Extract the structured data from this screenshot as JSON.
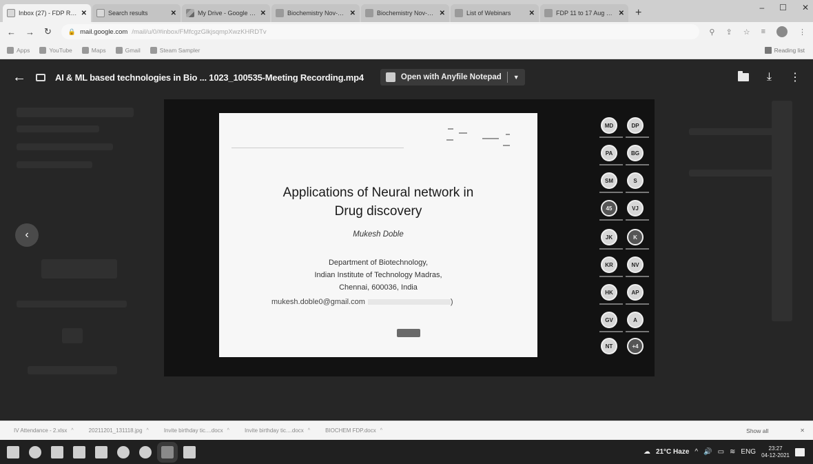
{
  "browser": {
    "tabs": [
      {
        "title": "Inbox (27) - FDP Recording",
        "favicon": "gmail"
      },
      {
        "title": "Search results",
        "favicon": "gmail"
      },
      {
        "title": "My Drive - Google Drive",
        "favicon": "drive"
      },
      {
        "title": "Biochemistry Nov-Dec",
        "favicon": "doc"
      },
      {
        "title": "Biochemistry Nov-Dec",
        "favicon": "doc"
      },
      {
        "title": "List of Webinars",
        "favicon": "doc"
      },
      {
        "title": "FDP 11 to 17 Aug 2021",
        "favicon": "doc"
      }
    ],
    "new_tab_label": "+",
    "window_controls": {
      "minimize": "–",
      "maximize": "☐",
      "close": "✕"
    },
    "url_host": "mail.google.com",
    "url_path": "/mail/u/0/#inbox/FMfcgzGlkjsqmpXwzKHRDTv",
    "bookmarks": [
      {
        "label": "Apps",
        "icon": "apps-grid-icon"
      },
      {
        "label": "YouTube",
        "icon": "youtube-icon"
      },
      {
        "label": "Maps",
        "icon": "maps-icon"
      },
      {
        "label": "Gmail",
        "icon": "gmail-icon"
      },
      {
        "label": "Steam Sampler",
        "icon": "steam-icon"
      }
    ],
    "reading_list_label": "Reading list"
  },
  "viewer": {
    "file_name": "AI & ML based technologies in Bio ... 1023_100535-Meeting Recording.mp4",
    "open_with_label": "Open with Anyfile Notepad"
  },
  "slide": {
    "title_line1": "Applications of Neural network in",
    "title_line2": "Drug discovery",
    "author": "Mukesh Doble",
    "aff_line1": "Department of Biotechnology,",
    "aff_line2": "Indian Institute of Technology Madras,",
    "aff_line3": "Chennai, 600036, India",
    "email": "mukesh.doble0@gmail.com",
    "email_tail": ")"
  },
  "participants": [
    {
      "initials": "MD",
      "dark": false
    },
    {
      "initials": "DP",
      "dark": false
    },
    {
      "initials": "PA",
      "dark": false
    },
    {
      "initials": "BG",
      "dark": false
    },
    {
      "initials": "SM",
      "dark": false
    },
    {
      "initials": "S",
      "dark": false
    },
    {
      "initials": "45",
      "dark": true
    },
    {
      "initials": "VJ",
      "dark": false
    },
    {
      "initials": "JK",
      "dark": false
    },
    {
      "initials": "K",
      "dark": true
    },
    {
      "initials": "KR",
      "dark": false
    },
    {
      "initials": "NV",
      "dark": false
    },
    {
      "initials": "HK",
      "dark": false
    },
    {
      "initials": "AP",
      "dark": false
    },
    {
      "initials": "GV",
      "dark": false
    },
    {
      "initials": "A",
      "dark": false
    },
    {
      "initials": "NT",
      "dark": false
    },
    {
      "initials": "+4",
      "dark": true
    }
  ],
  "downloads": [
    "IV Attendance - 2.xlsx",
    "20211201_131118.jpg",
    "Invite birthday tic....docx",
    "Invite birthday tic....docx",
    "BIOCHEM FDP.docx"
  ],
  "show_all_label": "Show all",
  "taskbar": {
    "weather": "21°C Haze",
    "lang": "ENG",
    "time": "23:27",
    "date": "04-12-2021"
  }
}
